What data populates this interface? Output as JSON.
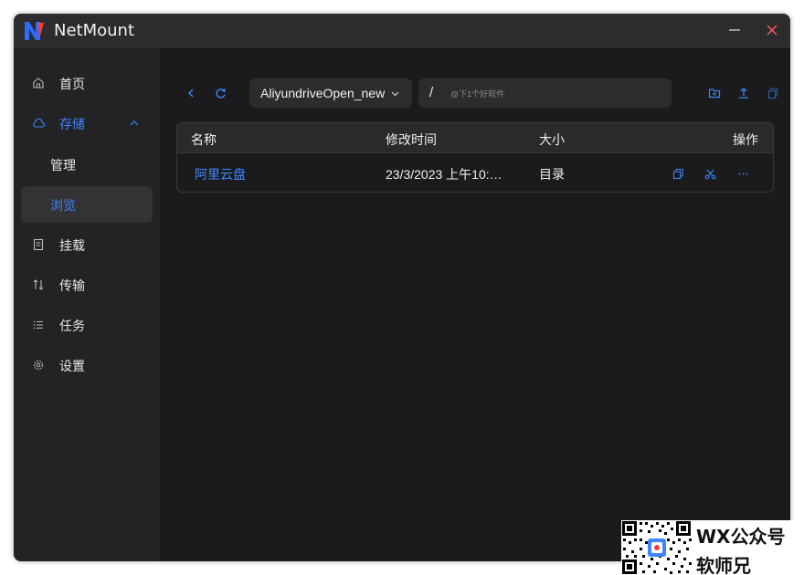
{
  "app": {
    "title": "NetMount"
  },
  "colors": {
    "accent": "#3e86ff",
    "logo_blue": "#2f6bff",
    "logo_red": "#ff3b30",
    "close_red": "#ff5a5a"
  },
  "sidebar": {
    "items": [
      {
        "label": "首页",
        "icon": "home-icon"
      },
      {
        "label": "存储",
        "icon": "cloud-icon",
        "expanded": true
      },
      {
        "label": "管理"
      },
      {
        "label": "浏览",
        "selected": true
      },
      {
        "label": "挂载",
        "icon": "mount-icon"
      },
      {
        "label": "传输",
        "icon": "transfer-icon"
      },
      {
        "label": "任务",
        "icon": "task-list-icon"
      },
      {
        "label": "设置",
        "icon": "gear-icon"
      }
    ]
  },
  "toolbar": {
    "storage_select": {
      "value": "AliyundriveOpen_new"
    },
    "path": {
      "value": "/",
      "placeholder": "@下1个好软件"
    },
    "icons": [
      "back-icon",
      "refresh-icon",
      "new-folder-icon",
      "upload-icon",
      "paste-icon"
    ]
  },
  "table": {
    "headers": {
      "name": "名称",
      "modified": "修改时间",
      "size": "大小",
      "actions": "操作"
    },
    "rows": [
      {
        "name": "阿里云盘",
        "modified": "23/3/2023 上午10:…",
        "size": "目录",
        "actions": [
          "copy-icon",
          "cut-icon",
          "more-icon"
        ]
      }
    ]
  },
  "watermark": {
    "line1": "WX公众号",
    "line2": "软师兄"
  }
}
